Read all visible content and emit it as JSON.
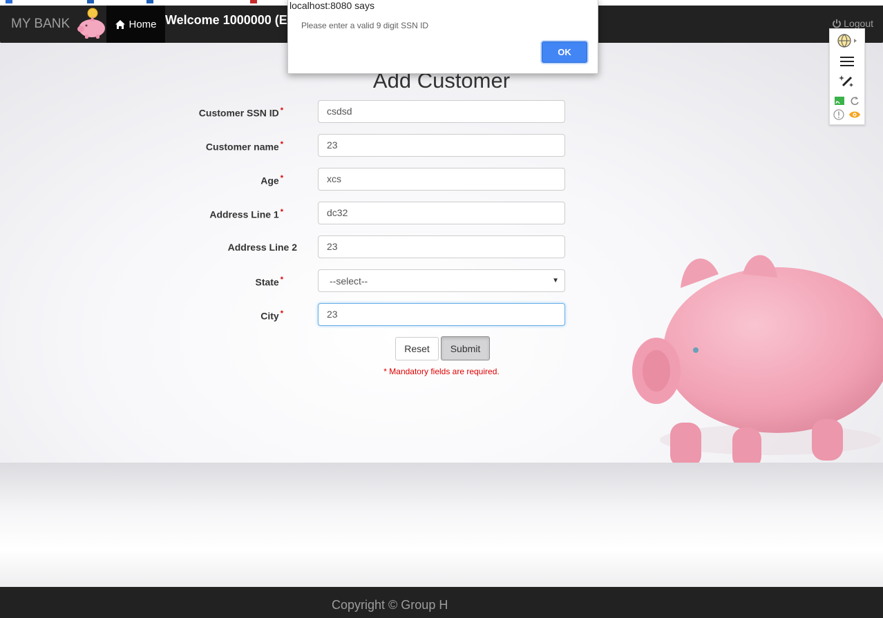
{
  "navbar": {
    "brand": "MY BANK",
    "home_label": "Home",
    "welcome": "Welcome 1000000 (E",
    "logout_label": "Logout"
  },
  "form": {
    "title": "Add Customer",
    "fields": [
      {
        "label": "Customer SSN ID",
        "value": "csdsd",
        "required": true
      },
      {
        "label": "Customer name",
        "value": "23",
        "required": true
      },
      {
        "label": "Age",
        "value": "xcs",
        "required": true
      },
      {
        "label": "Address Line 1",
        "value": "dc32",
        "required": true
      },
      {
        "label": "Address Line 2",
        "value": "23",
        "required": false
      },
      {
        "label": "State",
        "value": "--select--",
        "required": true
      },
      {
        "label": "City",
        "value": "23",
        "required": true
      }
    ],
    "reset_label": "Reset",
    "submit_label": "Submit",
    "mandatory_note": "* Mandatory fields are required."
  },
  "dialog": {
    "title": "localhost:8080 says",
    "message": "Please enter a valid 9 digit SSN ID",
    "ok_label": "OK"
  },
  "footer": {
    "copyright": "Copyright © Group H"
  },
  "colors": {
    "navbar_bg": "#222222",
    "required": "#dd0000",
    "dialog_ok": "#4285f4",
    "pig_pink": "#f4a8b8"
  }
}
